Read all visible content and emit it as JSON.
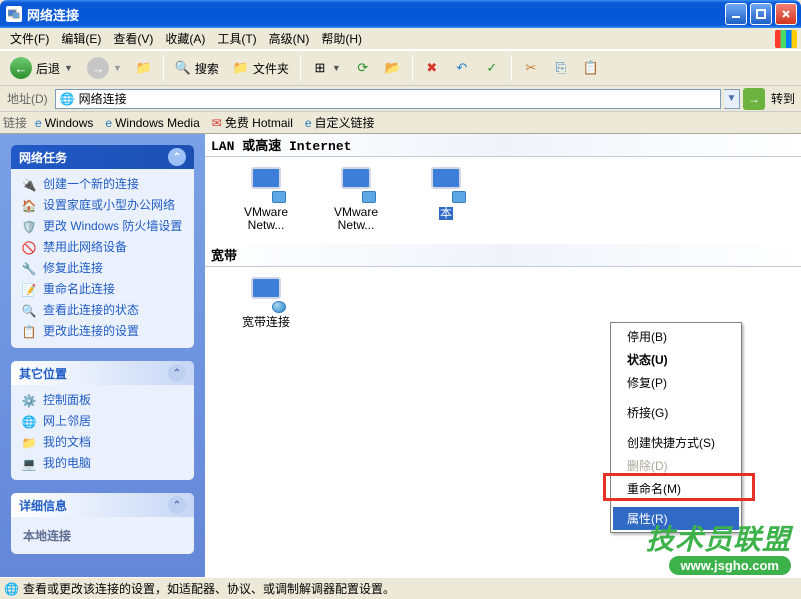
{
  "window": {
    "title": "网络连接"
  },
  "menubar": {
    "items": [
      "文件(F)",
      "编辑(E)",
      "查看(V)",
      "收藏(A)",
      "工具(T)",
      "高级(N)",
      "帮助(H)"
    ]
  },
  "toolbar": {
    "back": "后退",
    "search": "搜索",
    "folders": "文件夹"
  },
  "addressbar": {
    "label": "地址(D)",
    "value": "网络连接",
    "go": "转到"
  },
  "linksbar": {
    "label": "链接",
    "items": [
      "Windows",
      "Windows Media",
      "免费 Hotmail",
      "自定义链接"
    ]
  },
  "sidepanel": {
    "tasks": {
      "title": "网络任务",
      "items": [
        "创建一个新的连接",
        "设置家庭或小型办公网络",
        "更改 Windows 防火墙设置",
        "禁用此网络设备",
        "修复此连接",
        "重命名此连接",
        "查看此连接的状态",
        "更改此连接的设置"
      ]
    },
    "other": {
      "title": "其它位置",
      "items": [
        "控制面板",
        "网上邻居",
        "我的文档",
        "我的电脑"
      ]
    },
    "details": {
      "title": "详细信息",
      "line1": "本地连接"
    }
  },
  "content": {
    "section1": "LAN 或高速 Internet",
    "section2": "宽带",
    "icons_lan": [
      {
        "name": "VMware Netw..."
      },
      {
        "name": "VMware Netw..."
      },
      {
        "name": "本"
      }
    ],
    "icons_bb": [
      {
        "name": "宽带连接"
      }
    ]
  },
  "contextmenu": {
    "items": [
      {
        "label": "停用(B)",
        "type": "item"
      },
      {
        "label": "状态(U)",
        "type": "bold"
      },
      {
        "label": "修复(P)",
        "type": "item"
      },
      {
        "type": "sep"
      },
      {
        "label": "桥接(G)",
        "type": "item"
      },
      {
        "type": "sep"
      },
      {
        "label": "创建快捷方式(S)",
        "type": "item"
      },
      {
        "label": "删除(D)",
        "type": "disabled"
      },
      {
        "label": "重命名(M)",
        "type": "item"
      },
      {
        "type": "sep"
      },
      {
        "label": "属性(R)",
        "type": "selected"
      }
    ]
  },
  "statusbar": {
    "text": "查看或更改该连接的设置，如适配器、协议、或调制解调器配置设置。"
  },
  "watermark": {
    "line1": "技术员联盟",
    "line2": "www.jsgho.com"
  }
}
